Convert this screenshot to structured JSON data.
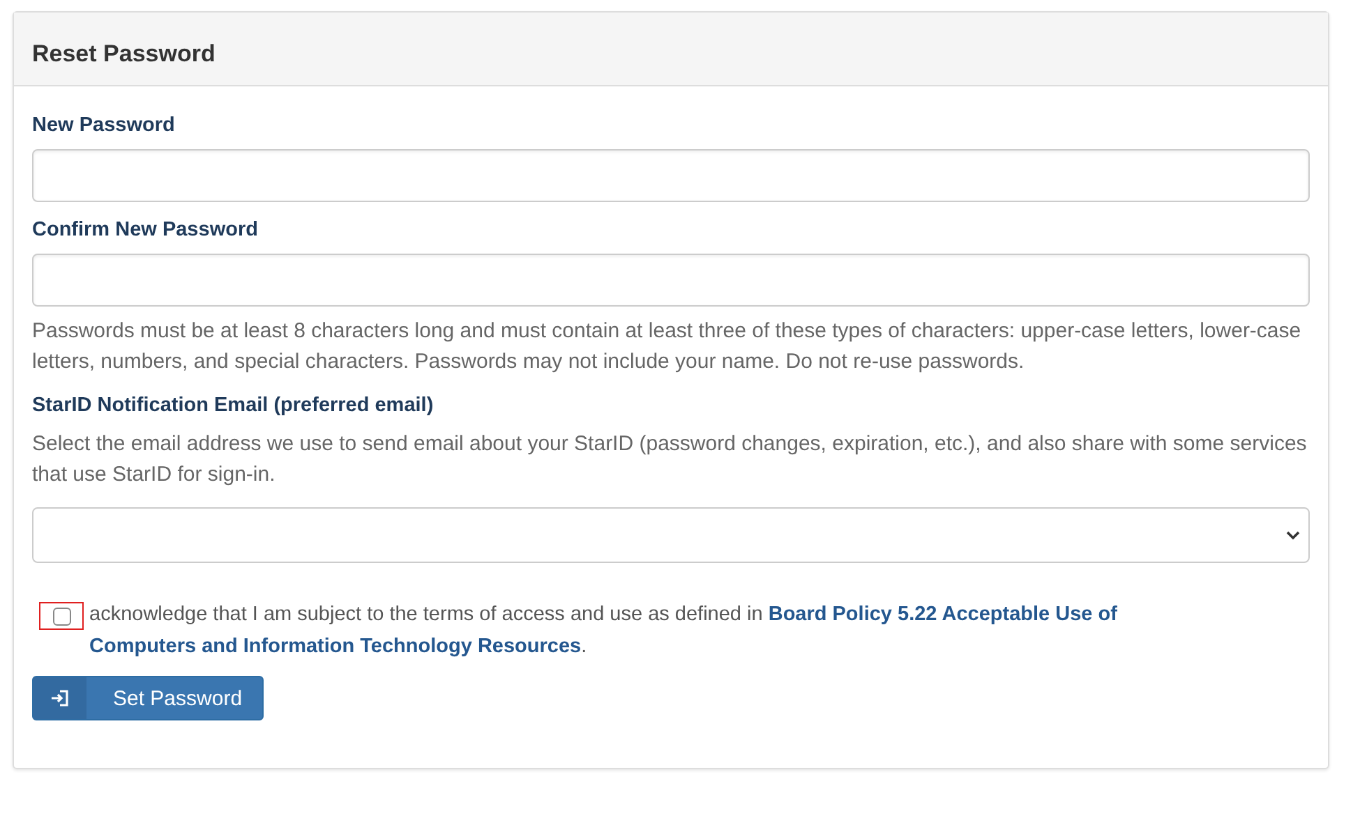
{
  "panel": {
    "title": "Reset Password"
  },
  "fields": [
    {
      "label": "New Password",
      "kind": "password"
    },
    {
      "label": "Confirm New Password",
      "kind": "password",
      "help": "Passwords must be at least 8 characters long and must contain at least three of these types of characters: upper-case letters, lower-case letters, numbers, and special characters. Passwords may not include your name. Do not re-use passwords."
    },
    {
      "label": "StarID Notification Email (preferred email)",
      "kind": "select",
      "description": "Select the email address we use to send email about your StarID (password changes, expiration, etc.), and also share with some services that use StarID for sign-in."
    }
  ],
  "agreement": {
    "checked": false,
    "highlighted": true,
    "text": "acknowledge that I am subject to the terms of access and use as defined in ",
    "link": [
      "Board Policy 5.22 Acceptable Use of",
      "Computers and Information Technology Resources"
    ],
    "end": "."
  },
  "submit": {
    "label": "Set Password"
  }
}
